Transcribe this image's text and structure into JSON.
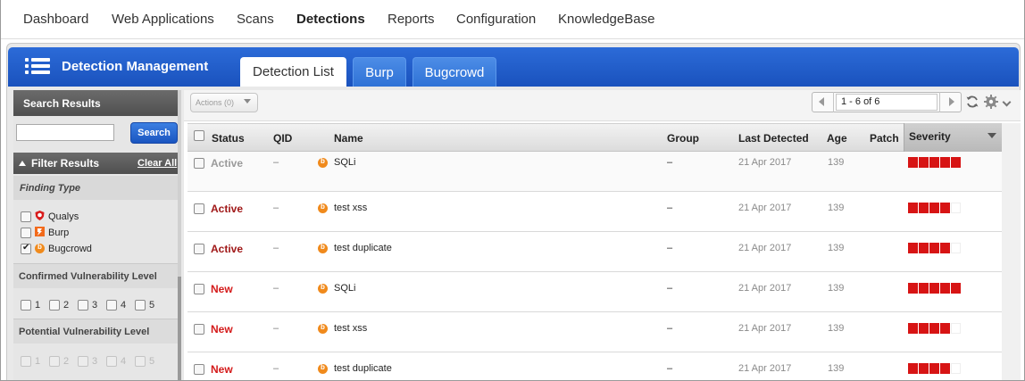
{
  "topnav": {
    "items": [
      {
        "label": "Dashboard",
        "active": false
      },
      {
        "label": "Web Applications",
        "active": false
      },
      {
        "label": "Scans",
        "active": false
      },
      {
        "label": "Detections",
        "active": true
      },
      {
        "label": "Reports",
        "active": false
      },
      {
        "label": "Configuration",
        "active": false
      },
      {
        "label": "KnowledgeBase",
        "active": false
      }
    ]
  },
  "app": {
    "title": "Detection Management",
    "menu_icon": "list-menu-icon",
    "tabs": [
      {
        "label": "Detection List",
        "selected": true
      },
      {
        "label": "Burp",
        "selected": false
      },
      {
        "label": "Bugcrowd",
        "selected": false
      }
    ]
  },
  "sidebar": {
    "search_header": "Search Results",
    "search_value": "",
    "search_button": "Search",
    "filter_header": "Filter Results",
    "clear_all": "Clear All",
    "finding_type": {
      "title": "Finding Type",
      "options": [
        {
          "label": "Qualys",
          "checked": false,
          "icon": "qualys-shield-icon"
        },
        {
          "label": "Burp",
          "checked": false,
          "icon": "burp-icon"
        },
        {
          "label": "Bugcrowd",
          "checked": true,
          "icon": "bugcrowd-icon"
        }
      ]
    },
    "confirmed_level": {
      "title": "Confirmed Vulnerability Level",
      "levels": [
        "1",
        "2",
        "3",
        "4",
        "5"
      ],
      "enabled": true
    },
    "potential_level": {
      "title": "Potential Vulnerability Level",
      "levels": [
        "1",
        "2",
        "3",
        "4",
        "5"
      ],
      "enabled": false
    }
  },
  "toolbar": {
    "actions_label": "Actions (0)",
    "pager_text": "1 - 6 of 6",
    "refresh_icon": "refresh-icon",
    "settings_icon": "gear-icon"
  },
  "table": {
    "columns": {
      "status": "Status",
      "qid": "QID",
      "name": "Name",
      "group": "Group",
      "last_detected": "Last Detected",
      "age": "Age",
      "patch": "Patch",
      "severity": "Severity"
    },
    "rows": [
      {
        "status": "Active",
        "qid": "–",
        "name": "SQLi",
        "group": "–",
        "last_detected": "21 Apr 2017",
        "age": "139",
        "severity": 5
      },
      {
        "status": "Active",
        "qid": "–",
        "name": "test xss",
        "group": "–",
        "last_detected": "21 Apr 2017",
        "age": "139",
        "severity": 4
      },
      {
        "status": "Active",
        "qid": "–",
        "name": "test duplicate",
        "group": "–",
        "last_detected": "21 Apr 2017",
        "age": "139",
        "severity": 4
      },
      {
        "status": "New",
        "qid": "–",
        "name": "SQLi",
        "group": "–",
        "last_detected": "21 Apr 2017",
        "age": "139",
        "severity": 5
      },
      {
        "status": "New",
        "qid": "–",
        "name": "test xss",
        "group": "–",
        "last_detected": "21 Apr 2017",
        "age": "139",
        "severity": 4
      },
      {
        "status": "New",
        "qid": "–",
        "name": "test duplicate",
        "group": "–",
        "last_detected": "21 Apr 2017",
        "age": "139",
        "severity": 4
      }
    ]
  },
  "colors": {
    "brand_blue": "#1a52bd",
    "severity_red": "#d71414",
    "status_active": "#a01818",
    "status_new": "#d41a1a",
    "bugcrowd_orange": "#f08a1c"
  }
}
